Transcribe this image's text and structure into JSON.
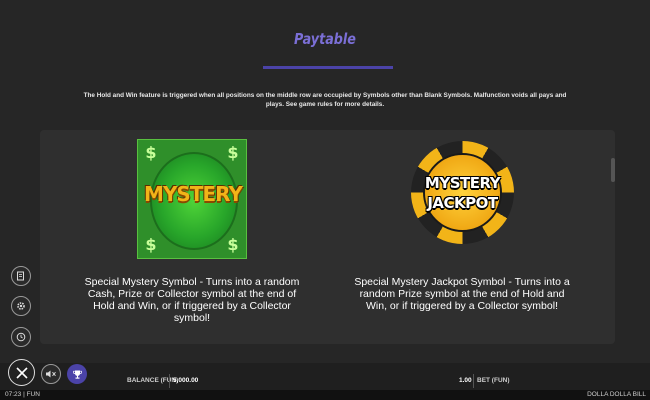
{
  "header": {
    "title": "Paytable",
    "intro": "The Hold and Win feature is triggered when all positions on the middle row are occupied by Symbols other than Blank Symbols. Malfunction voids all pays and plays. See game rules for more details."
  },
  "symbols": [
    {
      "name": "MYSTERY",
      "description": "Special Mystery Symbol - Turns into a random Cash, Prize or Collector symbol at the end of Hold and Win, or if triggered by a Collector symbol!"
    },
    {
      "name_line1": "MYSTERY",
      "name_line2": "JACKPOT",
      "description": "Special Mystery Jackpot Symbol - Turns into a random Prize symbol at the end of Hold and Win, or if triggered by a Collector symbol!"
    }
  ],
  "mystery_dollar": "$",
  "side_buttons": [
    "paytable-icon",
    "gear-icon",
    "history-icon"
  ],
  "bottom": {
    "balance_label": "BALANCE (FUN)",
    "balance_value": "5,000.00",
    "bet_value": "1.00",
    "bet_label": "BET (FUN)"
  },
  "status": {
    "time_mode": "07:23 | FUN",
    "game_name": "DOLLA DOLLA BILL"
  },
  "colors": {
    "accent": "#4b43a8",
    "title": "#7b6fd6",
    "background": "#262626",
    "panel": "#2f2f2f"
  }
}
